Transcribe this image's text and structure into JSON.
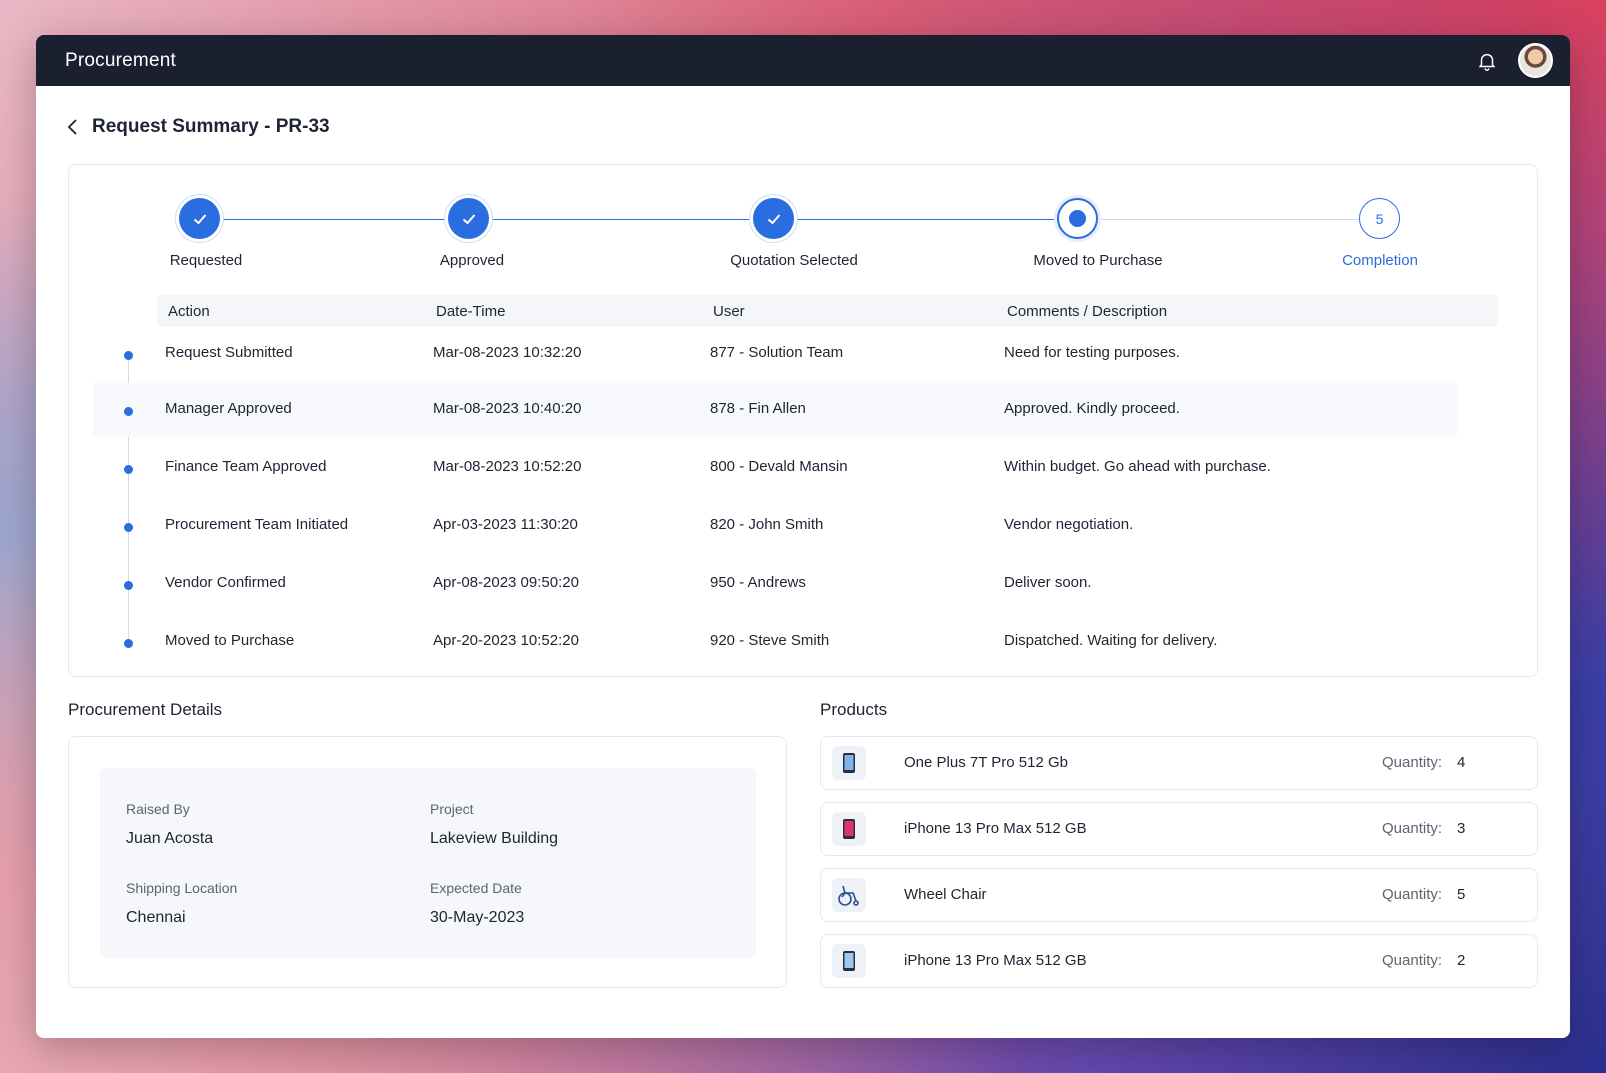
{
  "app": {
    "title": "Procurement"
  },
  "icons": {
    "notification": "bell-icon",
    "back": "chevron-left-icon",
    "check": "check-icon"
  },
  "colors": {
    "accent": "#2a6de0",
    "topbar": "#1b2030"
  },
  "page": {
    "title": "Request Summary - PR-33"
  },
  "stepper": {
    "steps": [
      {
        "label": "Requested",
        "state": "done"
      },
      {
        "label": "Approved",
        "state": "done"
      },
      {
        "label": "Quotation Selected",
        "state": "done"
      },
      {
        "label": "Moved to Purchase",
        "state": "current"
      },
      {
        "label": "Completion",
        "state": "pending",
        "number": "5"
      }
    ]
  },
  "history": {
    "columns": [
      "Action",
      "Date-Time",
      "User",
      "Comments / Description"
    ],
    "rows": [
      {
        "action": "Request Submitted",
        "datetime": "Mar-08-2023 10:32:20",
        "user": "877 - Solution Team",
        "comment": "Need for testing purposes."
      },
      {
        "action": "Manager Approved",
        "datetime": "Mar-08-2023 10:40:20",
        "user": "878 - Fin Allen",
        "comment": "Approved. Kindly proceed."
      },
      {
        "action": "Finance Team Approved",
        "datetime": "Mar-08-2023 10:52:20",
        "user": "800 - Devald Mansin",
        "comment": "Within budget. Go ahead with purchase."
      },
      {
        "action": "Procurement Team Initiated",
        "datetime": "Apr-03-2023 11:30:20",
        "user": "820 - John Smith",
        "comment": "Vendor negotiation."
      },
      {
        "action": "Vendor Confirmed",
        "datetime": "Apr-08-2023 09:50:20",
        "user": "950 - Andrews",
        "comment": "Deliver soon."
      },
      {
        "action": "Moved to Purchase",
        "datetime": "Apr-20-2023 10:52:20",
        "user": "920 - Steve Smith",
        "comment": "Dispatched. Waiting for delivery."
      }
    ]
  },
  "details": {
    "title": "Procurement Details",
    "raised_by_label": "Raised By",
    "raised_by": "Juan Acosta",
    "project_label": "Project",
    "project": "Lakeview Building",
    "shipping_label": "Shipping Location",
    "shipping": "Chennai",
    "expected_label": "Expected Date",
    "expected": "30-May-2023"
  },
  "products": {
    "title": "Products",
    "quantity_label": "Quantity:",
    "items": [
      {
        "name": "One Plus 7T Pro 512 Gb",
        "qty": "4",
        "icon": "phone-icon"
      },
      {
        "name": "iPhone 13 Pro Max 512 GB",
        "qty": "3",
        "icon": "phone-icon"
      },
      {
        "name": "Wheel Chair",
        "qty": "5",
        "icon": "wheelchair-icon"
      },
      {
        "name": "iPhone 13 Pro Max 512 GB",
        "qty": "2",
        "icon": "phone-icon"
      }
    ]
  }
}
